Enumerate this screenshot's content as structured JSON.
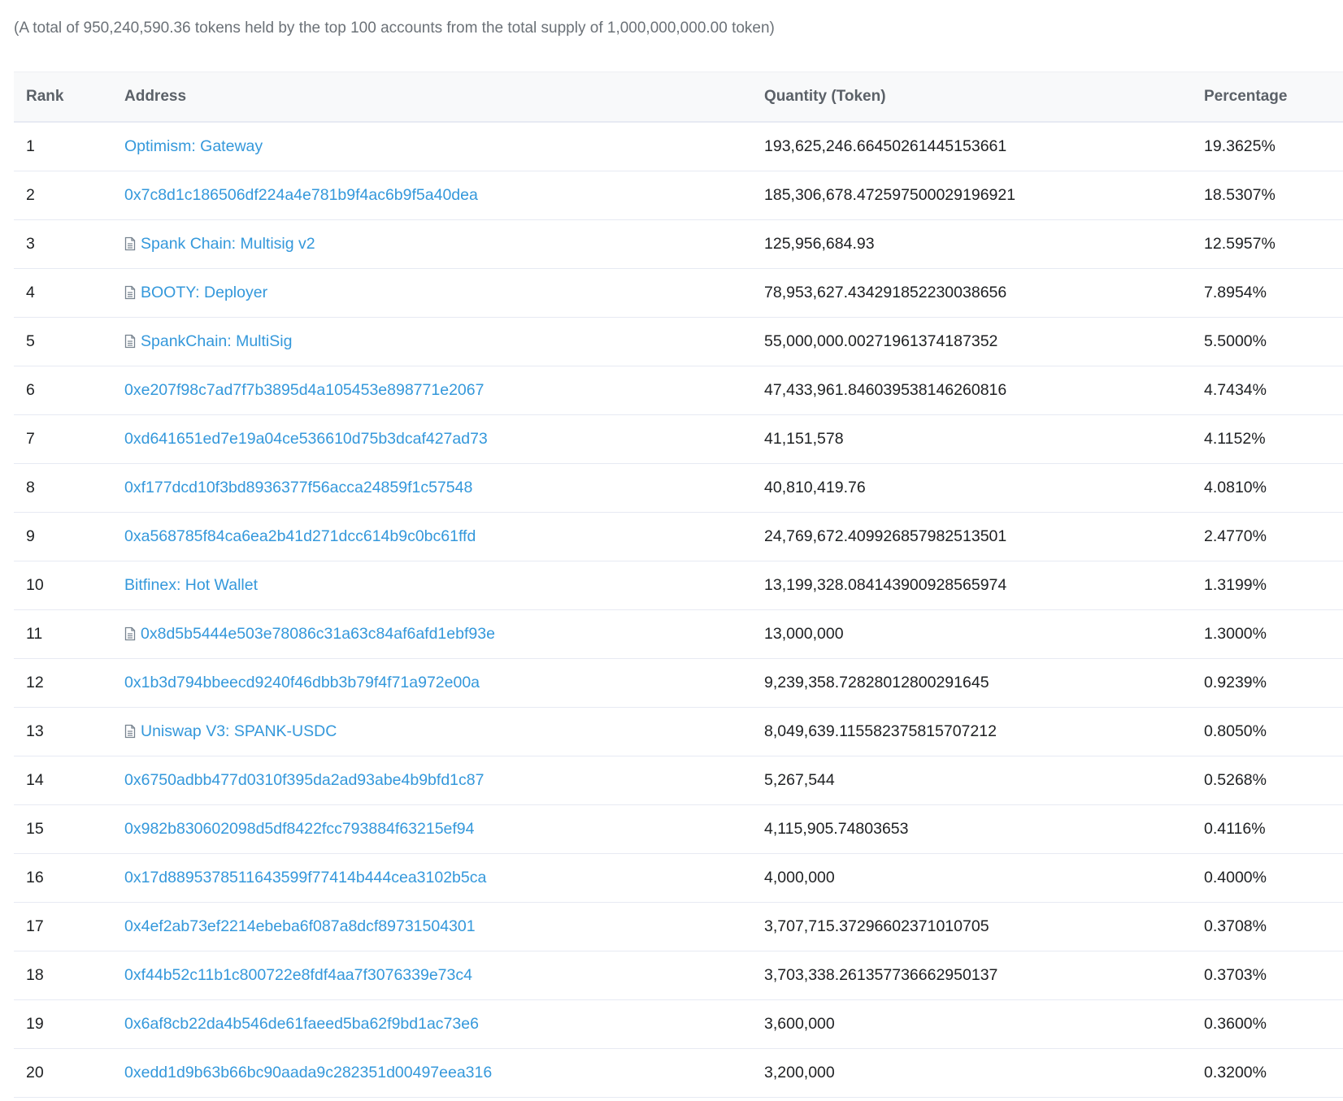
{
  "summary": "(A total of 950,240,590.36 tokens held by the top 100 accounts from the total supply of 1,000,000,000.00 token)",
  "columns": {
    "rank": "Rank",
    "address": "Address",
    "quantity": "Quantity (Token)",
    "percentage": "Percentage"
  },
  "colors": {
    "link": "#3498db",
    "header_bg": "#f8f9fa",
    "border": "#e7eaf3",
    "muted_text": "#6b7177"
  },
  "rows": [
    {
      "rank": "1",
      "address": "Optimism: Gateway",
      "contract": false,
      "quantity": "193,625,246.66450261445153661",
      "percentage": "19.3625%"
    },
    {
      "rank": "2",
      "address": "0x7c8d1c186506df224a4e781b9f4ac6b9f5a40dea",
      "contract": false,
      "quantity": "185,306,678.472597500029196921",
      "percentage": "18.5307%"
    },
    {
      "rank": "3",
      "address": "Spank Chain: Multisig v2",
      "contract": true,
      "quantity": "125,956,684.93",
      "percentage": "12.5957%"
    },
    {
      "rank": "4",
      "address": "BOOTY: Deployer",
      "contract": true,
      "quantity": "78,953,627.434291852230038656",
      "percentage": "7.8954%"
    },
    {
      "rank": "5",
      "address": "SpankChain: MultiSig",
      "contract": true,
      "quantity": "55,000,000.00271961374187352",
      "percentage": "5.5000%"
    },
    {
      "rank": "6",
      "address": "0xe207f98c7ad7f7b3895d4a105453e898771e2067",
      "contract": false,
      "quantity": "47,433,961.846039538146260816",
      "percentage": "4.7434%"
    },
    {
      "rank": "7",
      "address": "0xd641651ed7e19a04ce536610d75b3dcaf427ad73",
      "contract": false,
      "quantity": "41,151,578",
      "percentage": "4.1152%"
    },
    {
      "rank": "8",
      "address": "0xf177dcd10f3bd8936377f56acca24859f1c57548",
      "contract": false,
      "quantity": "40,810,419.76",
      "percentage": "4.0810%"
    },
    {
      "rank": "9",
      "address": "0xa568785f84ca6ea2b41d271dcc614b9c0bc61ffd",
      "contract": false,
      "quantity": "24,769,672.409926857982513501",
      "percentage": "2.4770%"
    },
    {
      "rank": "10",
      "address": "Bitfinex: Hot Wallet",
      "contract": false,
      "quantity": "13,199,328.084143900928565974",
      "percentage": "1.3199%"
    },
    {
      "rank": "11",
      "address": "0x8d5b5444e503e78086c31a63c84af6afd1ebf93e",
      "contract": true,
      "quantity": "13,000,000",
      "percentage": "1.3000%"
    },
    {
      "rank": "12",
      "address": "0x1b3d794bbeecd9240f46dbb3b79f4f71a972e00a",
      "contract": false,
      "quantity": "9,239,358.72828012800291645",
      "percentage": "0.9239%"
    },
    {
      "rank": "13",
      "address": "Uniswap V3: SPANK-USDC",
      "contract": true,
      "quantity": "8,049,639.115582375815707212",
      "percentage": "0.8050%"
    },
    {
      "rank": "14",
      "address": "0x6750adbb477d0310f395da2ad93abe4b9bfd1c87",
      "contract": false,
      "quantity": "5,267,544",
      "percentage": "0.5268%"
    },
    {
      "rank": "15",
      "address": "0x982b830602098d5df8422fcc793884f63215ef94",
      "contract": false,
      "quantity": "4,115,905.74803653",
      "percentage": "0.4116%"
    },
    {
      "rank": "16",
      "address": "0x17d8895378511643599f77414b444cea3102b5ca",
      "contract": false,
      "quantity": "4,000,000",
      "percentage": "0.4000%"
    },
    {
      "rank": "17",
      "address": "0x4ef2ab73ef2214ebeba6f087a8dcf89731504301",
      "contract": false,
      "quantity": "3,707,715.37296602371010705",
      "percentage": "0.3708%"
    },
    {
      "rank": "18",
      "address": "0xf44b52c11b1c800722e8fdf4aa7f3076339e73c4",
      "contract": false,
      "quantity": "3,703,338.261357736662950137",
      "percentage": "0.3703%"
    },
    {
      "rank": "19",
      "address": "0x6af8cb22da4b546de61faeed5ba62f9bd1ac73e6",
      "contract": false,
      "quantity": "3,600,000",
      "percentage": "0.3600%"
    },
    {
      "rank": "20",
      "address": "0xedd1d9b63b66bc90aada9c282351d00497eea316",
      "contract": false,
      "quantity": "3,200,000",
      "percentage": "0.3200%"
    }
  ]
}
